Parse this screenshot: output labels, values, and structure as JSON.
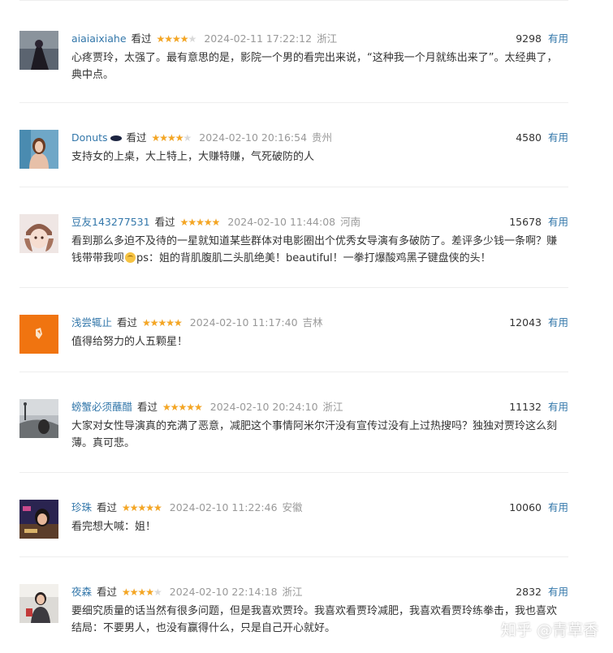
{
  "accent_color": "#3377aa",
  "star_color": "#f5a623",
  "watched_label": "看过",
  "useful_label": "有用",
  "comments": [
    {
      "user": "aiaiaixiahe",
      "rating": 4,
      "time": "2024-02-11 17:22:12",
      "location": "浙江",
      "votes": "9298",
      "text": "心疼贾玲，太强了。最有意思的是，影院一个男的看完出来说，“这种我一个月就练出来了”。太经典了，典中点。"
    },
    {
      "user": "Donuts",
      "badge_icon": "dark-oval-badge-icon",
      "rating": 4,
      "time": "2024-02-10 20:16:54",
      "location": "贵州",
      "votes": "4580",
      "text": "支持女的上桌，大上特上，大赚特赚，气死破防的人"
    },
    {
      "user": "豆友143277531",
      "rating": 5,
      "time": "2024-02-10 11:44:08",
      "location": "河南",
      "votes": "15678",
      "text_before_emoji": "看到那么多迫不及待的一星就知道某些群体对电影圈出个优秀女导演有多破防了。差评多少钱一条啊？赚钱带带我呗",
      "emoji": "embarrassed-emoji-icon",
      "text_after_emoji": "ps：姐的背肌腹肌二头肌绝美！beautiful！一拳打爆酸鸡黑子键盘侠的头！"
    },
    {
      "user": "浅尝辄止",
      "rating": 5,
      "time": "2024-02-10 11:17:40",
      "location": "吉林",
      "votes": "12043",
      "text": "值得给努力的人五颗星！"
    },
    {
      "user": "螃蟹必须蘸醋",
      "rating": 5,
      "time": "2024-02-10 20:24:10",
      "location": "浙江",
      "votes": "11132",
      "text": "大家对女性导演真的充满了恶意，减肥这个事情阿米尔汗没有宣传过没有上过热搜吗？独独对贾玲这么刻薄。真可悲。"
    },
    {
      "user": "珍珠",
      "rating": 5,
      "time": "2024-02-10 11:22:46",
      "location": "安徽",
      "votes": "10060",
      "text": "看完想大喊：姐！"
    },
    {
      "user": "夜森",
      "rating": 4,
      "time": "2024-02-10 22:14:18",
      "location": "浙江",
      "votes": "2832",
      "text": "要细究质量的话当然有很多问题，但是我喜欢贾玲。我喜欢看贾玲减肥，我喜欢看贾玲练拳击，我也喜欢结局：不要男人，也没有赢得什么，只是自己开心就好。"
    }
  ],
  "watermark": "知乎 @青草香"
}
